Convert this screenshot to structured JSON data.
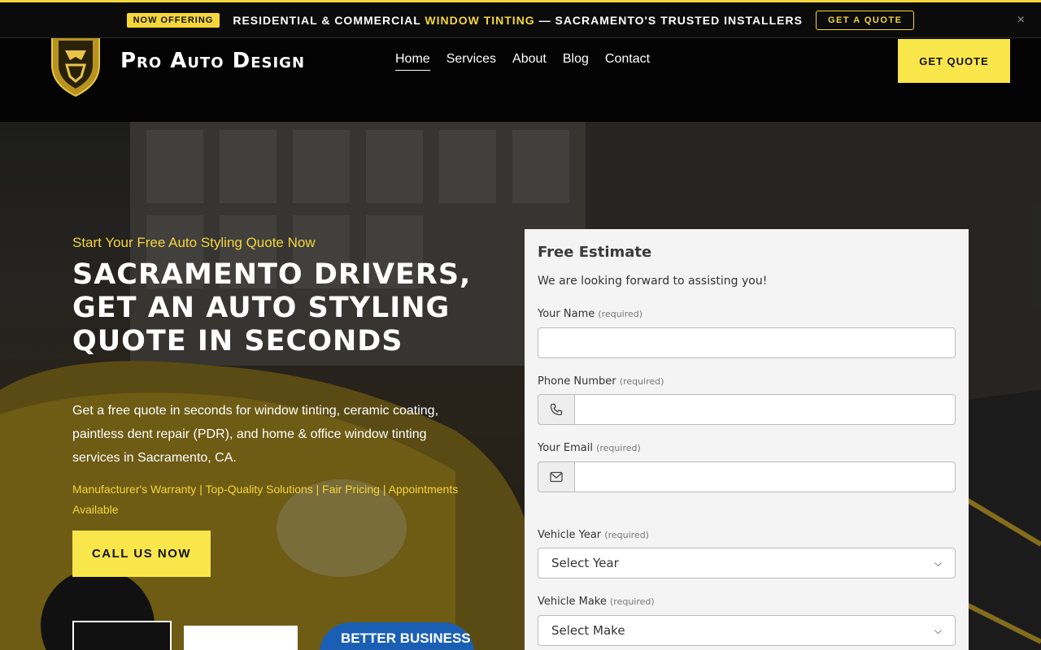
{
  "announcement": {
    "badge": "NOW OFFERING",
    "text_before": "RESIDENTIAL & COMMERCIAL ",
    "highlight": "WINDOW TINTING",
    "text_after": " — SACRAMENTO'S TRUSTED INSTALLERS",
    "cta": "GET A QUOTE",
    "close": "×"
  },
  "header": {
    "brand": "Pro Auto Design",
    "nav": [
      "Home",
      "Services",
      "About",
      "Blog",
      "Contact"
    ],
    "active_nav": "Home",
    "cta": "GET QUOTE"
  },
  "hero": {
    "eyebrow": "Start Your Free Auto Styling Quote Now",
    "headline": "SACRAMENTO DRIVERS, GET AN AUTO STYLING QUOTE IN SECONDS",
    "subtext": "Get a free quote in seconds for window tinting, ceramic coating, paintless dent repair (PDR), and home & office window tinting services in Sacramento, CA.",
    "perks": "Manufacturer's Warranty | Top-Quality Solutions | Fair Pricing | Appointments Available",
    "call_cta": "CALL US NOW",
    "badges": {
      "bbb": "BETTER BUSINESS"
    }
  },
  "form": {
    "title": "Free Estimate",
    "subtitle": "We are looking forward to assisting you!",
    "required_tag": "(required)",
    "fields": {
      "name": {
        "label": "Your Name",
        "value": "",
        "placeholder": ""
      },
      "phone": {
        "label": "Phone Number",
        "value": "",
        "placeholder": ""
      },
      "email": {
        "label": "Your Email",
        "value": "",
        "placeholder": ""
      },
      "year": {
        "label": "Vehicle Year",
        "selected": "Select Year"
      },
      "make": {
        "label": "Vehicle Make",
        "selected": "Select Make"
      }
    }
  },
  "colors": {
    "accent_yellow": "#f9e64a",
    "eyebrow_yellow": "#f5d63a",
    "header_bg": "#030303",
    "form_bg": "#f4f4f4"
  },
  "icons": [
    "logo-shield-icon",
    "phone-icon",
    "envelope-icon",
    "close-icon",
    "chevron-down-icon"
  ]
}
